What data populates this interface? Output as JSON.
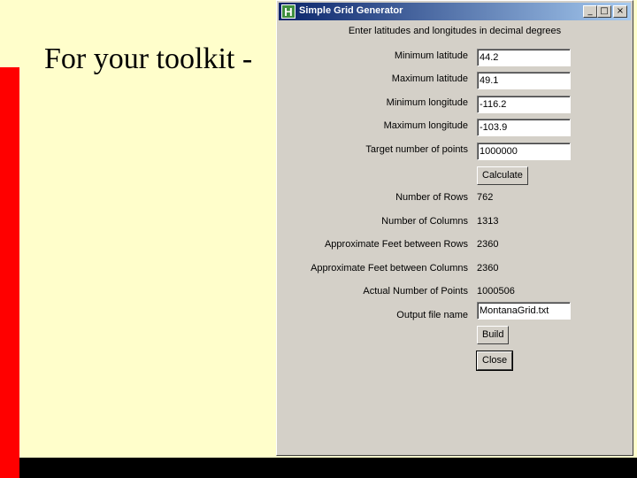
{
  "slide": {
    "title": "For your toolkit -"
  },
  "window": {
    "title": "Simple Grid Generator",
    "icon_letter": "H",
    "controls": {
      "minimize": "_",
      "maximize": "□",
      "close": "×"
    }
  },
  "form": {
    "instructions": "Enter latitudes and longitudes in decimal degrees",
    "inputs": [
      {
        "label": "Minimum latitude",
        "value": "44.2"
      },
      {
        "label": "Maximum latitude",
        "value": "49.1"
      },
      {
        "label": "Minimum longitude",
        "value": "-116.2"
      },
      {
        "label": "Maximum longitude",
        "value": "-103.9"
      },
      {
        "label": "Target number of points",
        "value": "1000000"
      }
    ],
    "calculate_label": "Calculate",
    "results": [
      {
        "label": "Number of Rows",
        "value": "762"
      },
      {
        "label": "Number of Columns",
        "value": "1313"
      },
      {
        "label": "Approximate Feet between Rows",
        "value": "2360"
      },
      {
        "label": "Approximate Feet between Columns",
        "value": "2360"
      },
      {
        "label": "Actual Number of Points",
        "value": "1000506"
      }
    ],
    "output_file": {
      "label": "Output file name",
      "value": "MontanaGrid.txt"
    },
    "build_label": "Build",
    "close_label": "Close"
  }
}
